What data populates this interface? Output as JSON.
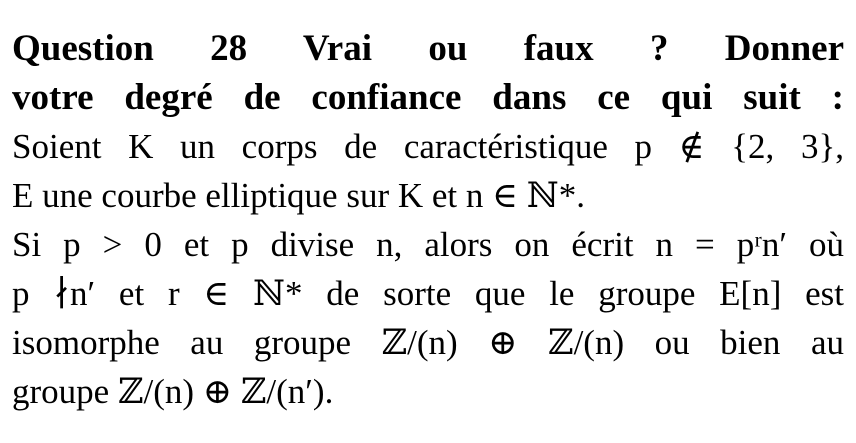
{
  "document": {
    "lines": [
      "Question 28 Vrai ou faux ? Donner",
      "votre degré de confiance dans ce qui suit :",
      "Soient K un corps de caractéristique p ∉ {2, 3},",
      "E une courbe elliptique sur K et n ∈ ℕ*.",
      "Si p > 0 et p divise n, alors on écrit n = pʳn′ où",
      "p ∤n′ et r ∈ ℕ* de sorte que le groupe E[n] est",
      "isomorphe au groupe ℤ/(n) ⊕ ℤ/(n) ou bien au",
      "groupe ℤ/(n) ⊕ ℤ/(n′)."
    ]
  }
}
